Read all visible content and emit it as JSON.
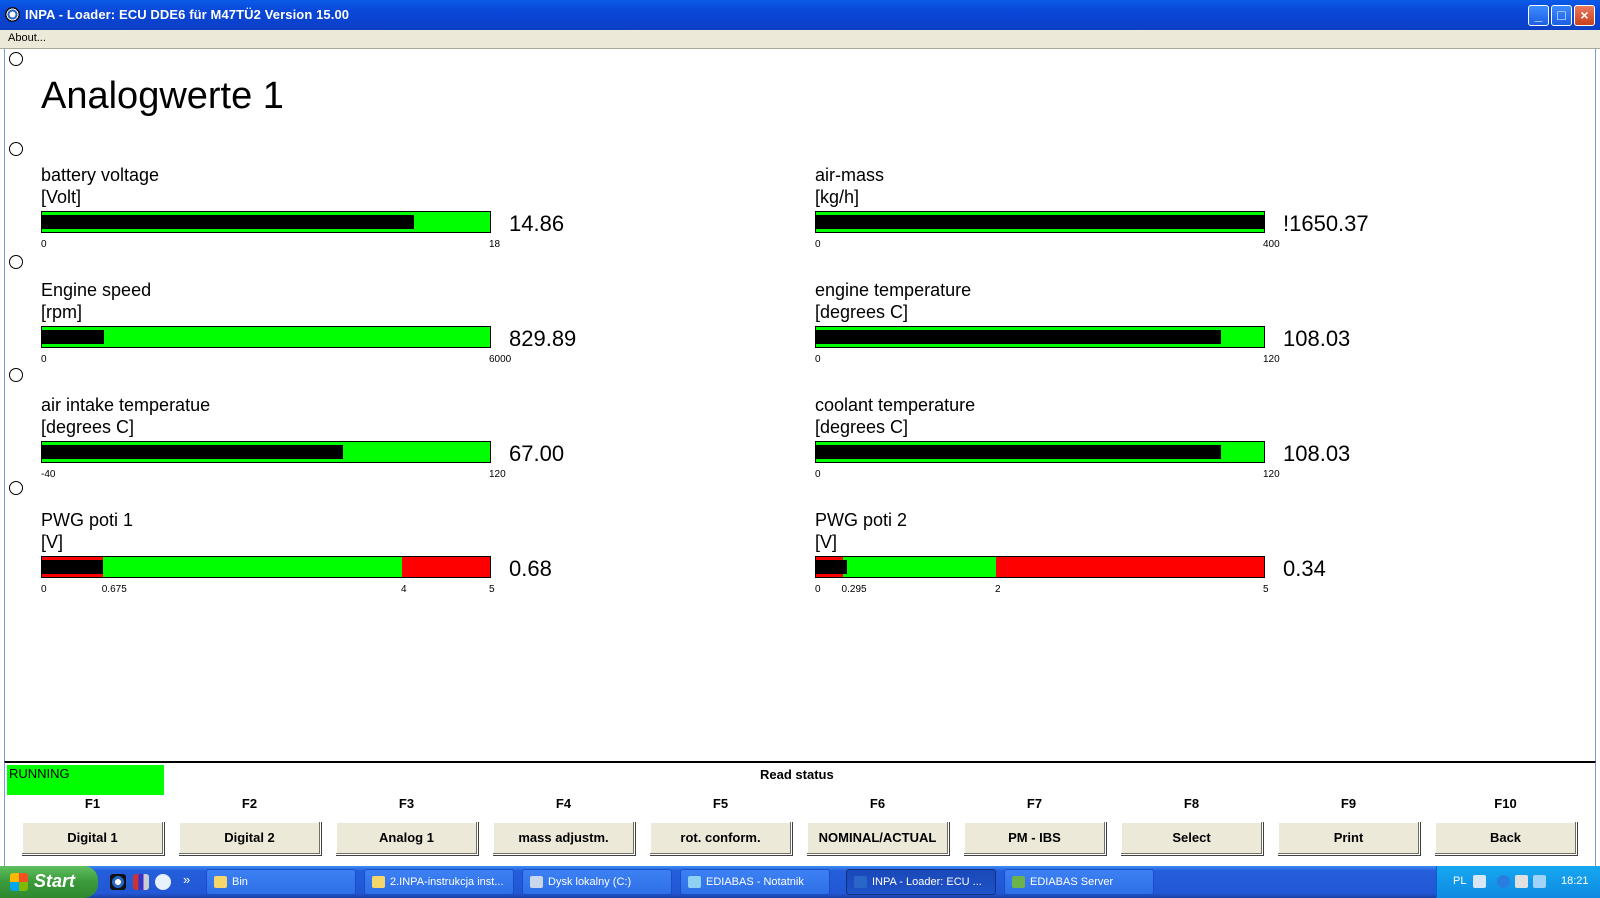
{
  "window": {
    "title": "INPA - Loader:  ECU DDE6 für M47TÜ2 Version 15.00",
    "menu_about": "About..."
  },
  "page": {
    "heading": "Analogwerte 1"
  },
  "gauges": [
    {
      "label": "battery voltage",
      "unit": "[Volt]",
      "value_text": "14.86",
      "value": 14.86,
      "min": 0,
      "max": 18,
      "ticks": [
        {
          "t": "0",
          "v": 0
        },
        {
          "t": "18",
          "v": 18
        }
      ],
      "red_zones": []
    },
    {
      "label": "air-mass",
      "unit": "[kg/h]",
      "value_text": "!1650.37",
      "value": 1650.37,
      "min": 0,
      "max": 400,
      "ticks": [
        {
          "t": "0",
          "v": 0
        },
        {
          "t": "400",
          "v": 400
        }
      ],
      "red_zones": []
    },
    {
      "label": "Engine speed",
      "unit": "[rpm]",
      "value_text": "829.89",
      "value": 829.89,
      "min": 0,
      "max": 6000,
      "ticks": [
        {
          "t": "0",
          "v": 0
        },
        {
          "t": "6000",
          "v": 6000
        }
      ],
      "red_zones": []
    },
    {
      "label": "engine temperature",
      "unit": "[degrees C]",
      "value_text": "108.03",
      "value": 108.03,
      "min": 0,
      "max": 120,
      "ticks": [
        {
          "t": "0",
          "v": 0
        },
        {
          "t": "120",
          "v": 120
        }
      ],
      "red_zones": []
    },
    {
      "label": "air intake temperatue",
      "unit": "[degrees C]",
      "value_text": "67.00",
      "value": 67.0,
      "min": -40,
      "max": 120,
      "ticks": [
        {
          "t": "-40",
          "v": -40
        },
        {
          "t": "120",
          "v": 120
        }
      ],
      "red_zones": []
    },
    {
      "label": "coolant temperature",
      "unit": "[degrees C]",
      "value_text": "108.03",
      "value": 108.03,
      "min": 0,
      "max": 120,
      "ticks": [
        {
          "t": "0",
          "v": 0
        },
        {
          "t": "120",
          "v": 120
        }
      ],
      "red_zones": []
    },
    {
      "label": "PWG poti 1",
      "unit": "[V]",
      "value_text": "0.68",
      "value": 0.68,
      "min": 0,
      "max": 5,
      "ticks": [
        {
          "t": "0",
          "v": 0
        },
        {
          "t": "0.675",
          "v": 0.675
        },
        {
          "t": "4",
          "v": 4
        },
        {
          "t": "5",
          "v": 5
        }
      ],
      "red_zones": [
        [
          0,
          0.675
        ],
        [
          4,
          5
        ]
      ]
    },
    {
      "label": "PWG poti 2",
      "unit": "[V]",
      "value_text": "0.34",
      "value": 0.34,
      "min": 0,
      "max": 5,
      "ticks": [
        {
          "t": "0",
          "v": 0
        },
        {
          "t": "0.295",
          "v": 0.295
        },
        {
          "t": "2",
          "v": 2
        },
        {
          "t": "5",
          "v": 5
        }
      ],
      "red_zones": [
        [
          0,
          0.295
        ],
        [
          2,
          5
        ]
      ]
    }
  ],
  "colors": {
    "bar_ok": "#00ff00",
    "bar_warn": "#ff0000",
    "bar_fill": "#000000",
    "running": "#00ff00"
  },
  "status": {
    "running": "RUNNING",
    "read_status": "Read status"
  },
  "fkeys": [
    {
      "key": "F1",
      "label": "Digital 1"
    },
    {
      "key": "F2",
      "label": "Digital 2"
    },
    {
      "key": "F3",
      "label": "Analog 1"
    },
    {
      "key": "F4",
      "label": "mass adjustm."
    },
    {
      "key": "F5",
      "label": "rot. conform."
    },
    {
      "key": "F6",
      "label": "NOMINAL/ACTUAL"
    },
    {
      "key": "F7",
      "label": "PM - IBS"
    },
    {
      "key": "F8",
      "label": "Select"
    },
    {
      "key": "F9",
      "label": "Print"
    },
    {
      "key": "F10",
      "label": "Back"
    }
  ],
  "taskbar": {
    "start": "Start",
    "more": "»",
    "tasks": [
      "Bin",
      "2.INPA-instrukcja inst...",
      "Dysk lokalny (C:)",
      "EDIABAS - Notatnik",
      "INPA - Loader:  ECU ...",
      "EDIABAS Server"
    ],
    "active_task": 4,
    "lang": "PL",
    "clock": "18:21"
  }
}
